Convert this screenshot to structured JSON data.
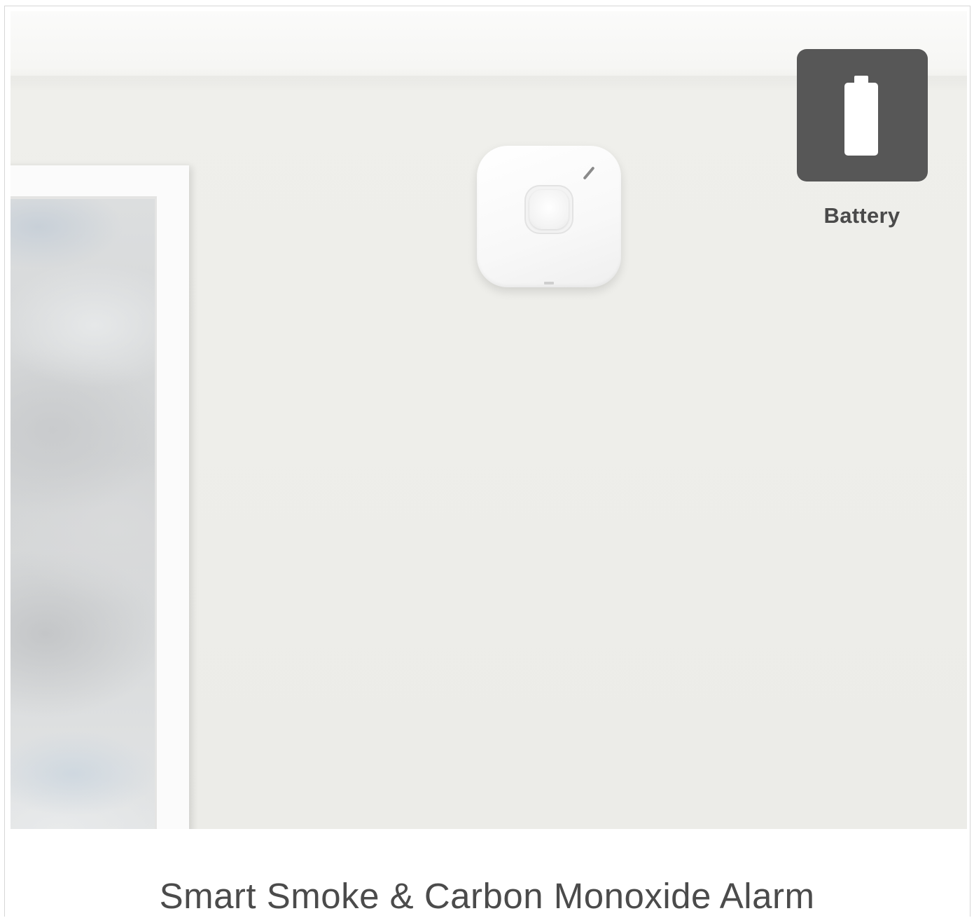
{
  "badge": {
    "icon": "battery-icon",
    "label": "Battery",
    "background": "#575757"
  },
  "product": {
    "title": "Smart Smoke & Carbon Monoxide Alarm"
  }
}
